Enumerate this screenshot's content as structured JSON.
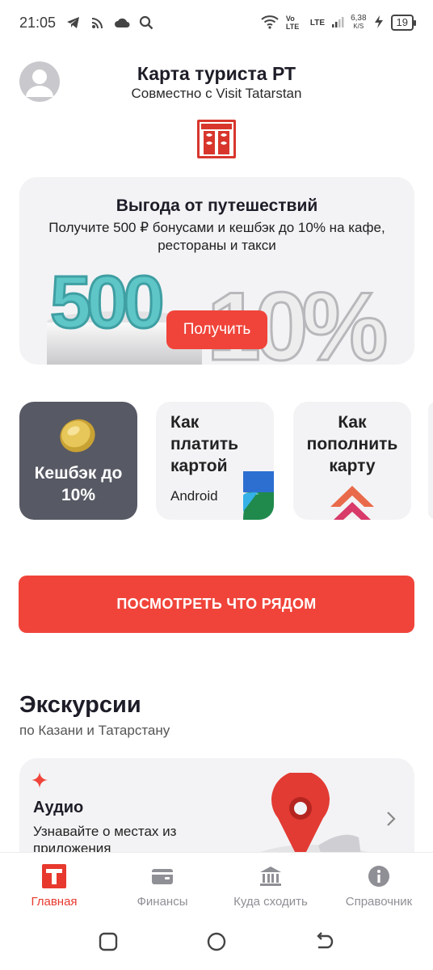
{
  "status_bar": {
    "time": "21:05",
    "net_speed_value": "6,38",
    "net_speed_unit": "K/S",
    "volte": "Vo LTE",
    "lte": "LTE",
    "battery": "19"
  },
  "header": {
    "title": "Карта туриста РТ",
    "subtitle": "Совместно с Visit Tatarstan"
  },
  "promo": {
    "title": "Выгода от путешествий",
    "text": "Получите 500 ₽ бонусами и кешбэк до 10% на кафе, рестораны и такси",
    "button": "Получить",
    "art_text_a": "500",
    "art_text_b": "10%"
  },
  "tiles": [
    {
      "label": "Кешбэк до 10%"
    },
    {
      "label": "Как платить картой",
      "sub": "Android"
    },
    {
      "label": "Как пополнить карту"
    }
  ],
  "cta": {
    "label": "ПОСМОТРЕТЬ ЧТО РЯДОМ"
  },
  "excursions": {
    "title": "Экскурсии",
    "subtitle": "по Казани и Татарстану",
    "card": {
      "title": "Аудио",
      "description": "Узнавайте о местах из приложения"
    }
  },
  "bottom_nav": [
    {
      "label": "Главная",
      "icon": "t-logo-icon",
      "active": true
    },
    {
      "label": "Финансы",
      "icon": "wallet-icon",
      "active": false
    },
    {
      "label": "Куда сходить",
      "icon": "museum-icon",
      "active": false
    },
    {
      "label": "Справочник",
      "icon": "info-icon",
      "active": false
    }
  ],
  "colors": {
    "accent": "#f0443a",
    "dark_tile": "#575964",
    "card_bg": "#f3f3f5",
    "nav_inactive": "#8f8f96"
  }
}
